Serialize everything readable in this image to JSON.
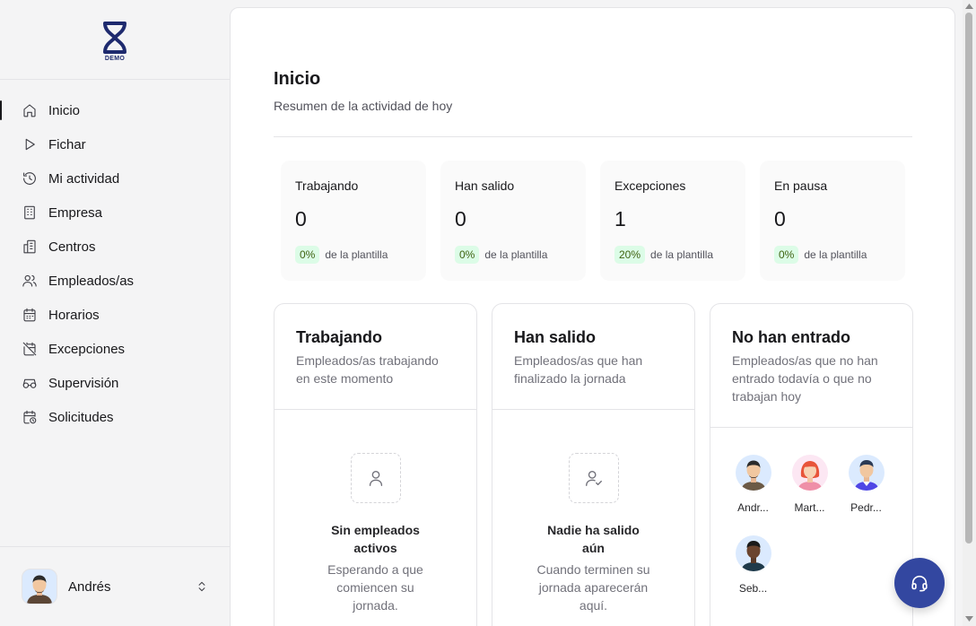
{
  "brand": {
    "logo_text": "DEMO",
    "accent": "#3347a0"
  },
  "sidebar": {
    "items": [
      {
        "label": "Inicio",
        "icon": "home-icon",
        "active": true
      },
      {
        "label": "Fichar",
        "icon": "play-icon"
      },
      {
        "label": "Mi actividad",
        "icon": "history-icon"
      },
      {
        "label": "Empresa",
        "icon": "building-icon"
      },
      {
        "label": "Centros",
        "icon": "buildings-icon"
      },
      {
        "label": "Empleados/as",
        "icon": "users-icon"
      },
      {
        "label": "Horarios",
        "icon": "calendar-icon"
      },
      {
        "label": "Excepciones",
        "icon": "calendar-off-icon"
      },
      {
        "label": "Supervisión",
        "icon": "glasses-icon"
      },
      {
        "label": "Solicitudes",
        "icon": "calendar-clock-icon"
      }
    ],
    "user": {
      "name": "Andrés"
    }
  },
  "page": {
    "title": "Inicio",
    "subtitle": "Resumen de la actividad de hoy"
  },
  "stats": [
    {
      "label": "Trabajando",
      "value": "0",
      "percent": "0%",
      "suffix": "de la plantilla"
    },
    {
      "label": "Han salido",
      "value": "0",
      "percent": "0%",
      "suffix": "de la plantilla"
    },
    {
      "label": "Excepciones",
      "value": "1",
      "percent": "20%",
      "suffix": "de la plantilla"
    },
    {
      "label": "En pausa",
      "value": "0",
      "percent": "0%",
      "suffix": "de la plantilla"
    }
  ],
  "cards": {
    "working": {
      "title": "Trabajando",
      "description": "Empleados/as trabajando en este momento",
      "empty_title": "Sin empleados activos",
      "empty_desc": "Esperando a que comiencen su jornada."
    },
    "left": {
      "title": "Han salido",
      "description": "Empleados/as que han finalizado la jornada",
      "empty_title": "Nadie ha salido aún",
      "empty_desc": "Cuando terminen su jornada aparecerán aquí."
    },
    "not_entered": {
      "title": "No han entrado",
      "description": "Empleados/as que no han entrado todavía o que no trabajan hoy",
      "people": [
        {
          "name": "Andr...",
          "avatar_bg": "#dbeafe"
        },
        {
          "name": "Mart...",
          "avatar_bg": "#fce7f3"
        },
        {
          "name": "Pedr...",
          "avatar_bg": "#dbeafe"
        },
        {
          "name": "Seb...",
          "avatar_bg": "#dbeafe"
        }
      ]
    }
  }
}
